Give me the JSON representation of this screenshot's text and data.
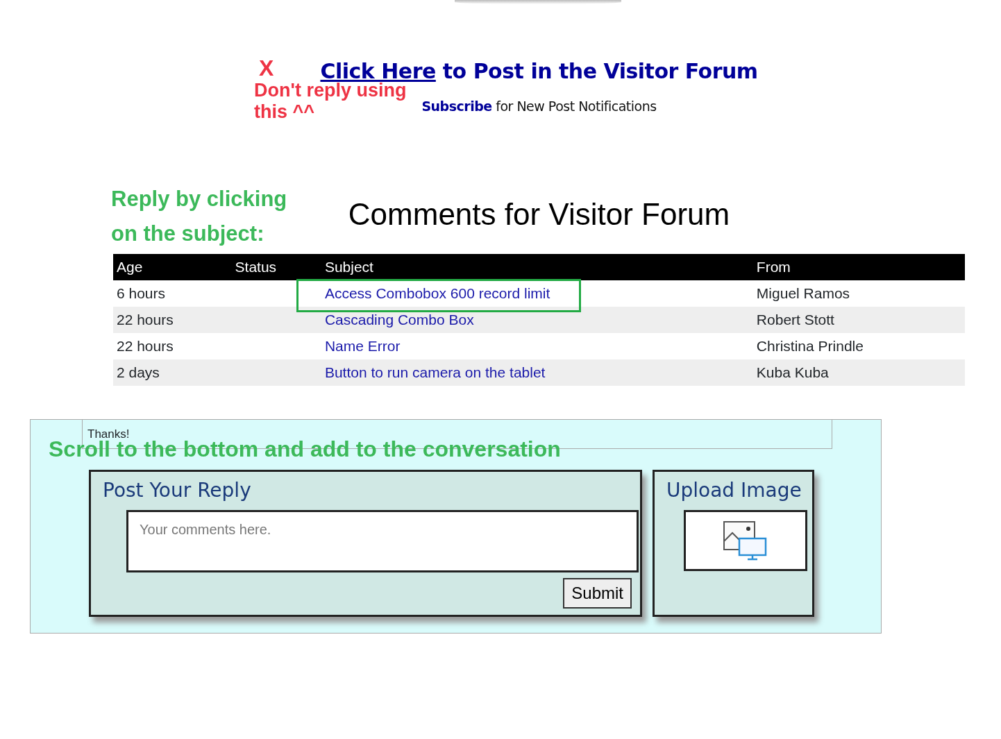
{
  "header": {
    "post_link": "Click Here",
    "post_rest": "to Post in the Visitor Forum",
    "subscribe_link": "Subscribe",
    "subscribe_rest": "for New Post Notifications"
  },
  "annotations": {
    "cross_mark": "X",
    "warning_note": "Don't reply using this ^^",
    "reply_hint": "Reply by clicking on the subject:",
    "scroll_hint": "Scroll to the bottom and add to the conversation"
  },
  "forum_title": "Comments for Visitor Forum",
  "table": {
    "columns": [
      "Age",
      "Status",
      "Subject",
      "From"
    ],
    "rows": [
      {
        "age": "6 hours",
        "subject": "Access Combobox 600 record limit",
        "from": "Miguel Ramos",
        "highlighted": true
      },
      {
        "age": "22 hours",
        "subject": "Cascading Combo Box",
        "from": "Robert Stott",
        "highlighted": false
      },
      {
        "age": "22 hours",
        "subject": "Name Error",
        "from": "Christina Prindle",
        "highlighted": false
      },
      {
        "age": "2 days",
        "subject": "Button to run camera on the tablet",
        "from": "Kuba Kuba",
        "highlighted": false
      }
    ]
  },
  "previous_message": {
    "text": "Thanks!"
  },
  "reply_form": {
    "title": "Post Your Reply",
    "placeholder": "Your comments here.",
    "submit": "Submit"
  },
  "upload": {
    "title": "Upload Image"
  }
}
